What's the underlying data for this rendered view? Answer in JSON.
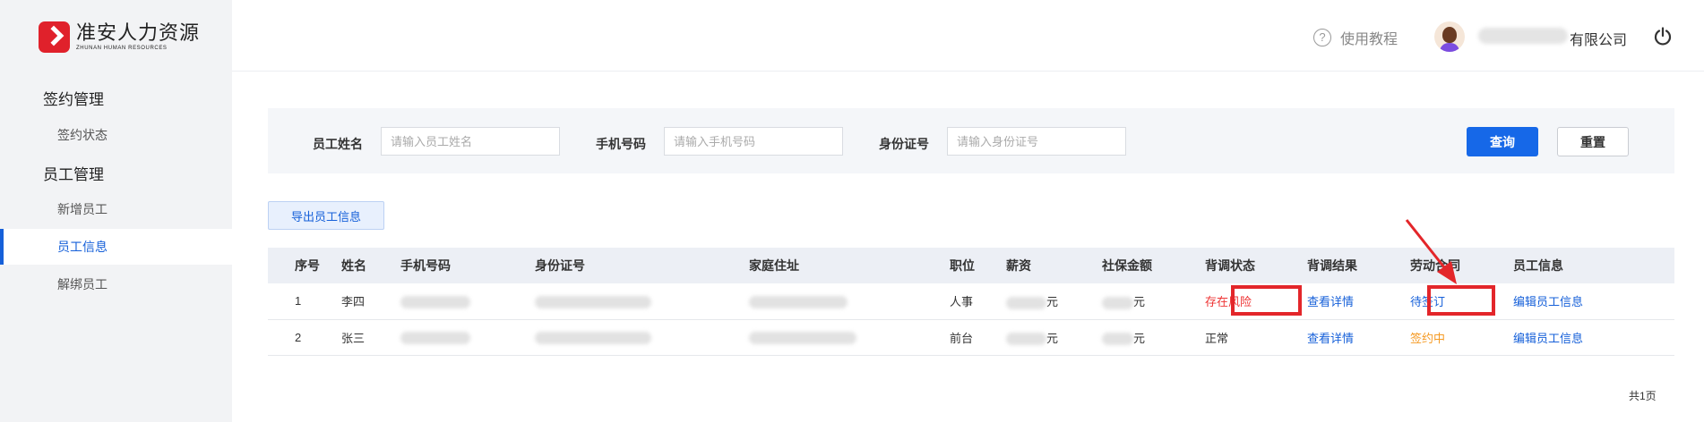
{
  "logo": {
    "cn": "准安人力资源",
    "en": "ZHUNAN HUMAN RESOURCES"
  },
  "sidebar": {
    "groups": [
      {
        "label": "签约管理",
        "items": [
          {
            "label": "签约状态"
          }
        ]
      },
      {
        "label": "员工管理",
        "items": [
          {
            "label": "新增员工"
          },
          {
            "label": "员工信息"
          },
          {
            "label": "解绑员工"
          }
        ]
      }
    ]
  },
  "header": {
    "help_label": "使用教程",
    "company_suffix": "有限公司"
  },
  "search": {
    "name_label": "员工姓名",
    "name_placeholder": "请输入员工姓名",
    "phone_label": "手机号码",
    "phone_placeholder": "请输入手机号码",
    "id_label": "身份证号",
    "id_placeholder": "请输入身份证号",
    "query_label": "查询",
    "reset_label": "重置"
  },
  "export_label": "导出员工信息",
  "table": {
    "columns": [
      "序号",
      "姓名",
      "手机号码",
      "身份证号",
      "家庭住址",
      "职位",
      "薪资",
      "社保金额",
      "背调状态",
      "背调结果",
      "劳动合同",
      "员工信息"
    ],
    "rows": [
      {
        "index": "1",
        "name": "李四",
        "position": "人事",
        "salary_unit": "元",
        "insurance_unit": "元",
        "bg_status": "存在风险",
        "bg_result": "查看详情",
        "contract": "待签订",
        "edit": "编辑员工信息"
      },
      {
        "index": "2",
        "name": "张三",
        "position": "前台",
        "salary_unit": "元",
        "insurance_unit": "元",
        "bg_status": "正常",
        "bg_result": "查看详情",
        "contract": "签约中",
        "edit": "编辑员工信息"
      }
    ]
  },
  "footer": {
    "pages": "共1页"
  },
  "colors": {
    "primary": "#1668e8",
    "risk": "#e33333",
    "pending": "#f59a23",
    "annotation": "#e3262a"
  }
}
